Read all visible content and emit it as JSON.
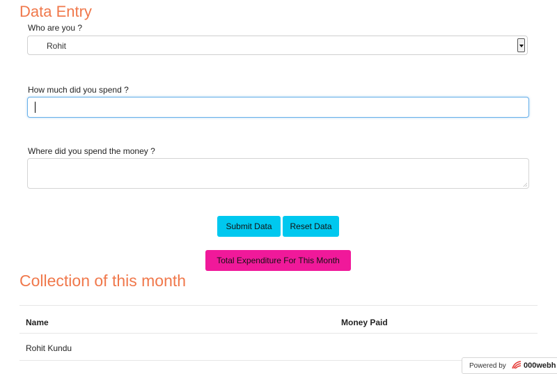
{
  "page": {
    "title": "Data Entry"
  },
  "form": {
    "who_label": "Who are you ?",
    "who_value": "Rohit",
    "spend_label": "How much did you spend ?",
    "spend_value": "",
    "where_label": "Where did you spend the money ?",
    "where_value": ""
  },
  "buttons": {
    "submit": "Submit Data",
    "reset": "Reset Data",
    "total": "Total Expenditure For This Month"
  },
  "collection": {
    "title": "Collection of this month",
    "headers": [
      "Name",
      "Money Paid"
    ],
    "rows": [
      [
        "Rohit Kundu",
        ""
      ]
    ]
  },
  "footer": {
    "powered_by": "Powered by",
    "brand": "000webh",
    "logo_icon": "000webhost-logo-icon"
  },
  "colors": {
    "heading": "#f0784b",
    "primary_button": "#00c8ef",
    "total_button": "#f0199a"
  }
}
